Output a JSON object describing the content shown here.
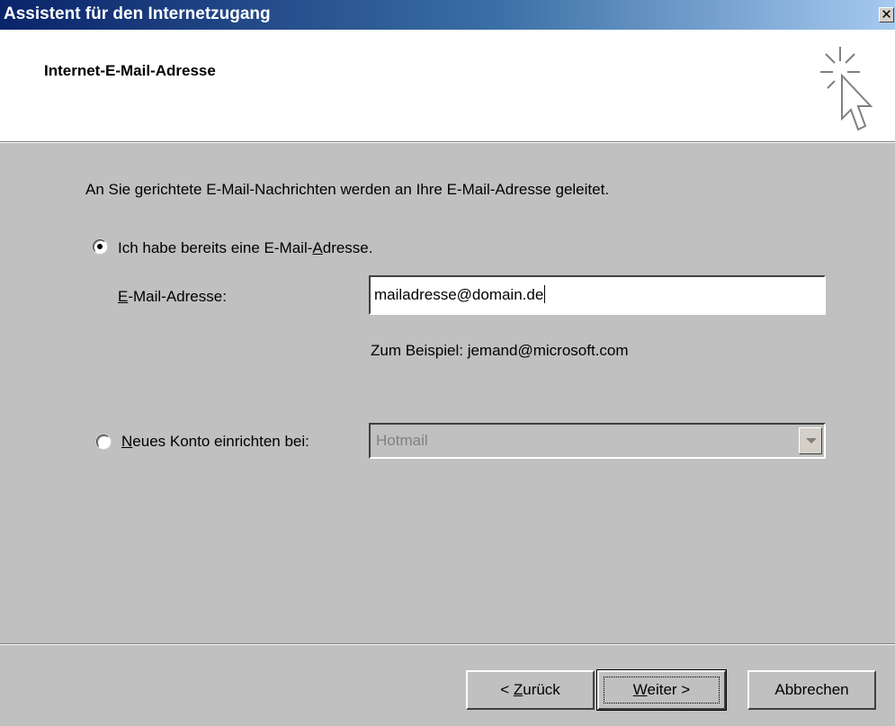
{
  "window": {
    "title": "Assistent für den Internetzugang",
    "close_symbol": "✕"
  },
  "header": {
    "title": "Internet-E-Mail-Adresse",
    "icon": "wizard-pointer-icon"
  },
  "body": {
    "intro": "An Sie gerichtete E-Mail-Nachrichten werden an Ihre E-Mail-Adresse geleitet.",
    "option_existing": {
      "label_before": "Ich habe bereits eine E-Mail-",
      "label_accel": "A",
      "label_after": "dresse.",
      "selected": true
    },
    "email_field": {
      "label_accel": "E",
      "label_rest": "-Mail-Adresse:",
      "value": "mailadresse@domain.de"
    },
    "example": "Zum Beispiel: jemand@microsoft.com",
    "option_new": {
      "label_accel": "N",
      "label_rest": "eues Konto einrichten bei:",
      "selected": false
    },
    "provider_select": {
      "value": "Hotmail",
      "disabled": true
    }
  },
  "footer": {
    "back": {
      "prefix": "< ",
      "accel": "Z",
      "rest": "urück"
    },
    "next": {
      "accel": "W",
      "rest": "eiter >"
    },
    "cancel": {
      "label": "Abbrechen"
    }
  }
}
